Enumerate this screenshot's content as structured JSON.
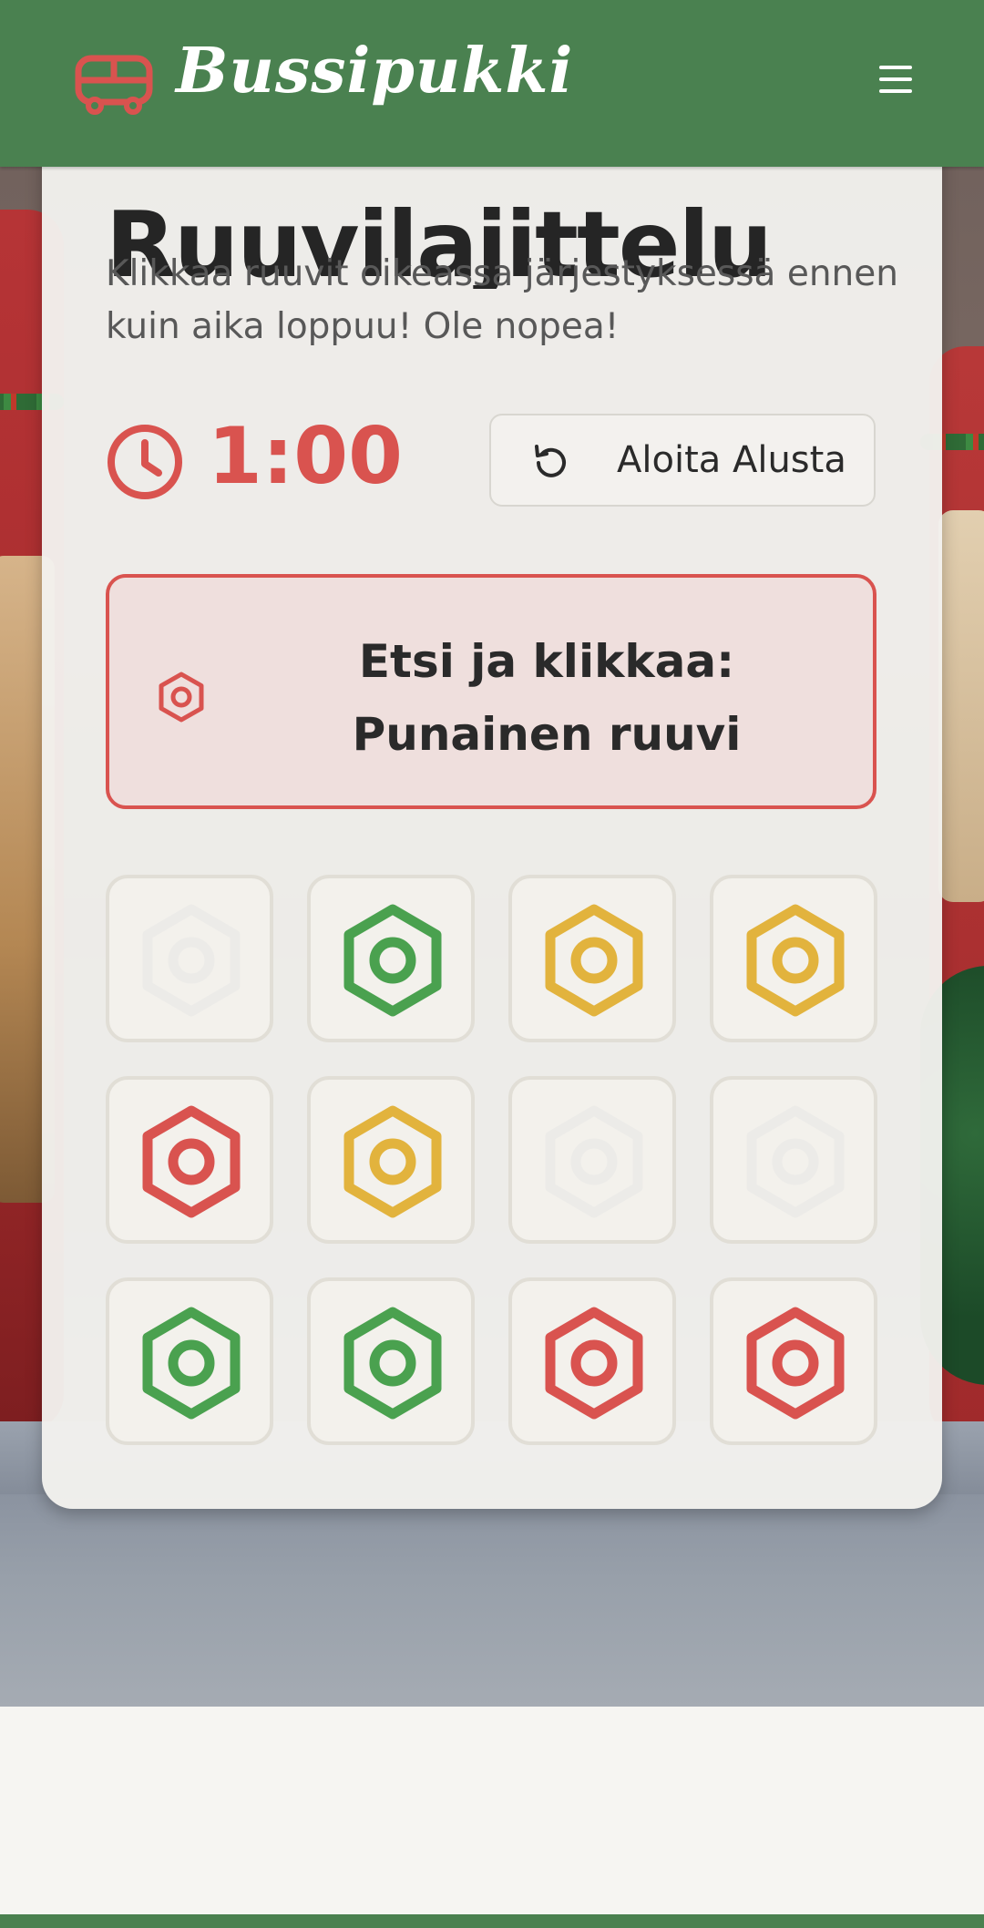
{
  "header": {
    "brand": "Bussipukki",
    "logo_icon": "bus-icon",
    "menu_icon": "hamburger-menu-icon"
  },
  "game": {
    "title": "Ruuvilajittelu",
    "subtitle": "Klikkaa ruuvit oikeassa järjestyksessä ennen kuin aika loppuu! Ole nopea!",
    "timer_icon": "clock-icon",
    "timer": "1:00",
    "restart_icon": "rotate-ccw-icon",
    "restart_label": "Aloita Alusta",
    "target_icon": "hex-nut-icon",
    "target_text": "Etsi ja klikkaa: Punainen ruuvi",
    "target_color": "#d9534f",
    "tiles": [
      {
        "color": "faded"
      },
      {
        "color": "green"
      },
      {
        "color": "yellow"
      },
      {
        "color": "yellow"
      },
      {
        "color": "red"
      },
      {
        "color": "yellow"
      },
      {
        "color": "faded"
      },
      {
        "color": "faded"
      },
      {
        "color": "green"
      },
      {
        "color": "green"
      },
      {
        "color": "red"
      },
      {
        "color": "red"
      }
    ]
  },
  "colors": {
    "primary_green": "#4a8150",
    "red": "#d9534f",
    "green": "#4aa14f",
    "yellow": "#e2b33d",
    "faded": "#ecebe8"
  }
}
